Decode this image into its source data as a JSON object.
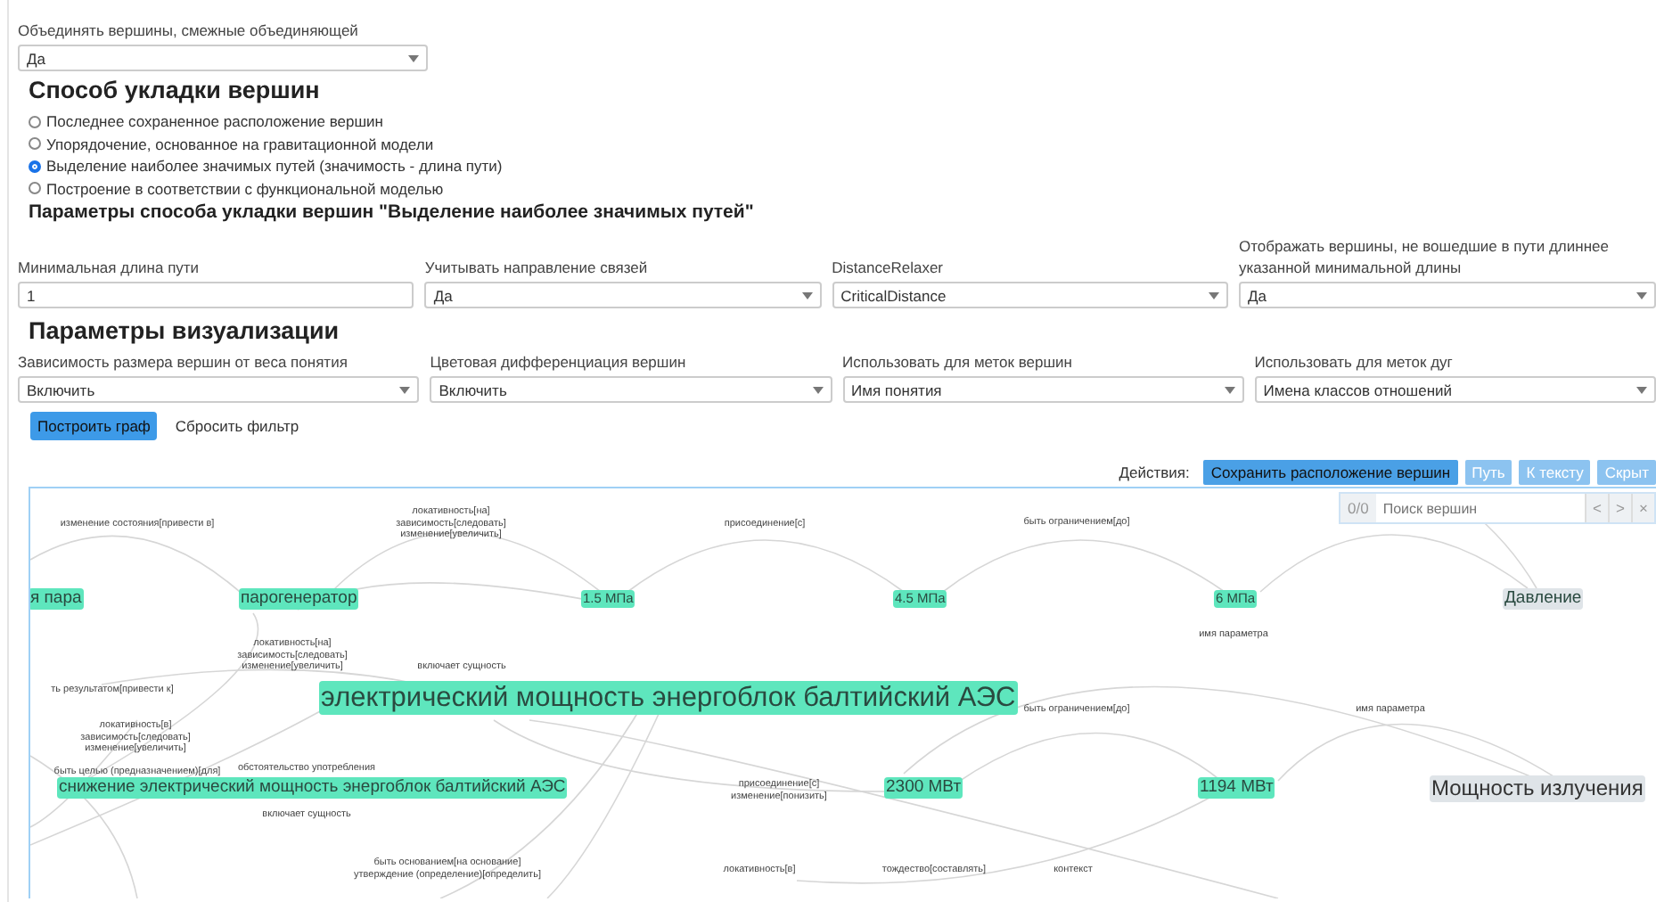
{
  "merge_field": {
    "label": "Объединять вершины, смежные объединяющей",
    "value": "Да"
  },
  "layout_section": {
    "title": "Способ укладки вершин",
    "options": [
      {
        "label": "Последнее сохраненное расположение вершин",
        "selected": false
      },
      {
        "label": "Упорядочение, основанное на гравитационной модели",
        "selected": false
      },
      {
        "label": "Выделение наиболее значимых путей (значимость - длина пути)",
        "selected": true
      },
      {
        "label": "Построение в соответствии с функциональной моделью",
        "selected": false
      }
    ]
  },
  "layout_params": {
    "title": "Параметры способа укладки вершин \"Выделение наиболее значимых путей\"",
    "fields": [
      {
        "label": "Минимальная длина пути",
        "kind": "input",
        "value": "1"
      },
      {
        "label": "Учитывать направление связей",
        "kind": "select",
        "value": "Да"
      },
      {
        "label": "DistanceRelaxer",
        "kind": "select",
        "value": "CriticalDistance"
      },
      {
        "label": "Отображать вершины, не вошедшие в пути длиннее указанной минимальной длины",
        "kind": "select",
        "value": "Да"
      }
    ]
  },
  "visualization": {
    "title": "Параметры визуализации",
    "fields": [
      {
        "label": "Зависимость размера вершин от веса понятия",
        "value": "Включить"
      },
      {
        "label": "Цветовая дифференциация вершин",
        "value": "Включить"
      },
      {
        "label": "Использовать для меток вершин",
        "value": "Имя понятия"
      },
      {
        "label": "Использовать для меток дуг",
        "value": "Имена классов отношений"
      }
    ]
  },
  "buttons": [
    {
      "label": "Построить граф",
      "kind": "primary"
    },
    {
      "label": "Сбросить фильтр",
      "kind": "link"
    }
  ],
  "graph": {
    "actions_label": "Действия:",
    "actions": [
      {
        "label": "Сохранить расположение вершин",
        "kind": "primary"
      },
      {
        "label": "Путь",
        "kind": "secondary"
      },
      {
        "label": "К тексту",
        "kind": "secondary"
      },
      {
        "label": "Скрыт",
        "kind": "secondary"
      }
    ],
    "search": {
      "counter": "0/0",
      "placeholder": "Поиск вершин",
      "buttons": [
        "<",
        ">",
        "×"
      ]
    },
    "nodes": [
      {
        "label": "я пара",
        "kind": "medium",
        "color": "#5ee6bd"
      },
      {
        "label": "парогенератор",
        "kind": "medium",
        "color": "#5ee6bd"
      },
      {
        "label": "1.5 МПа",
        "kind": "small",
        "color": "#5ee6bd"
      },
      {
        "label": "4.5 МПа",
        "kind": "small",
        "color": "#5ee6bd"
      },
      {
        "label": "6 МПа",
        "kind": "small",
        "color": "#5ee6bd"
      },
      {
        "label": "Давление",
        "kind": "medium",
        "color": "#dfe4e8"
      },
      {
        "label": "электрический мощность энергоблок балтийский АЭС",
        "kind": "large",
        "color": "#5ee6bd"
      },
      {
        "label": "снижение электрический мощность энергоблок балтийский АЭС",
        "kind": "medium",
        "color": "#5ee6bd"
      },
      {
        "label": "2300 МВт",
        "kind": "medium",
        "color": "#5ee6bd"
      },
      {
        "label": "1194 МВт",
        "kind": "medium",
        "color": "#5ee6bd"
      },
      {
        "label": "Мощность излучения",
        "kind": "big",
        "color": "#dfe4e8"
      }
    ],
    "edge_labels": [
      "изменение состояния[привести в]",
      "локативность[на]\nзависимость[следовать]\nизменение[увеличить]",
      "присоединение[с]",
      "быть ограничением[до]",
      "локативность[на]\nзависимость[следовать]\nизменение[увеличить]",
      "ть результатом[привести к]",
      "включает сущность",
      "локативность[в]\nзависимость[следовать]\nизменение[увеличить]",
      "быть целью (предназначением)[для]",
      "обстоятельство употребления",
      "включает сущность",
      "присоединение[с]\nизменение[понизить]",
      "имя параметра",
      "быть ограничением[до]",
      "имя параметра",
      "быть основанием[на основание]\nутверждение (определение)[определить]",
      "локативность[в]",
      "тождество[составлять]",
      "контекст"
    ]
  }
}
